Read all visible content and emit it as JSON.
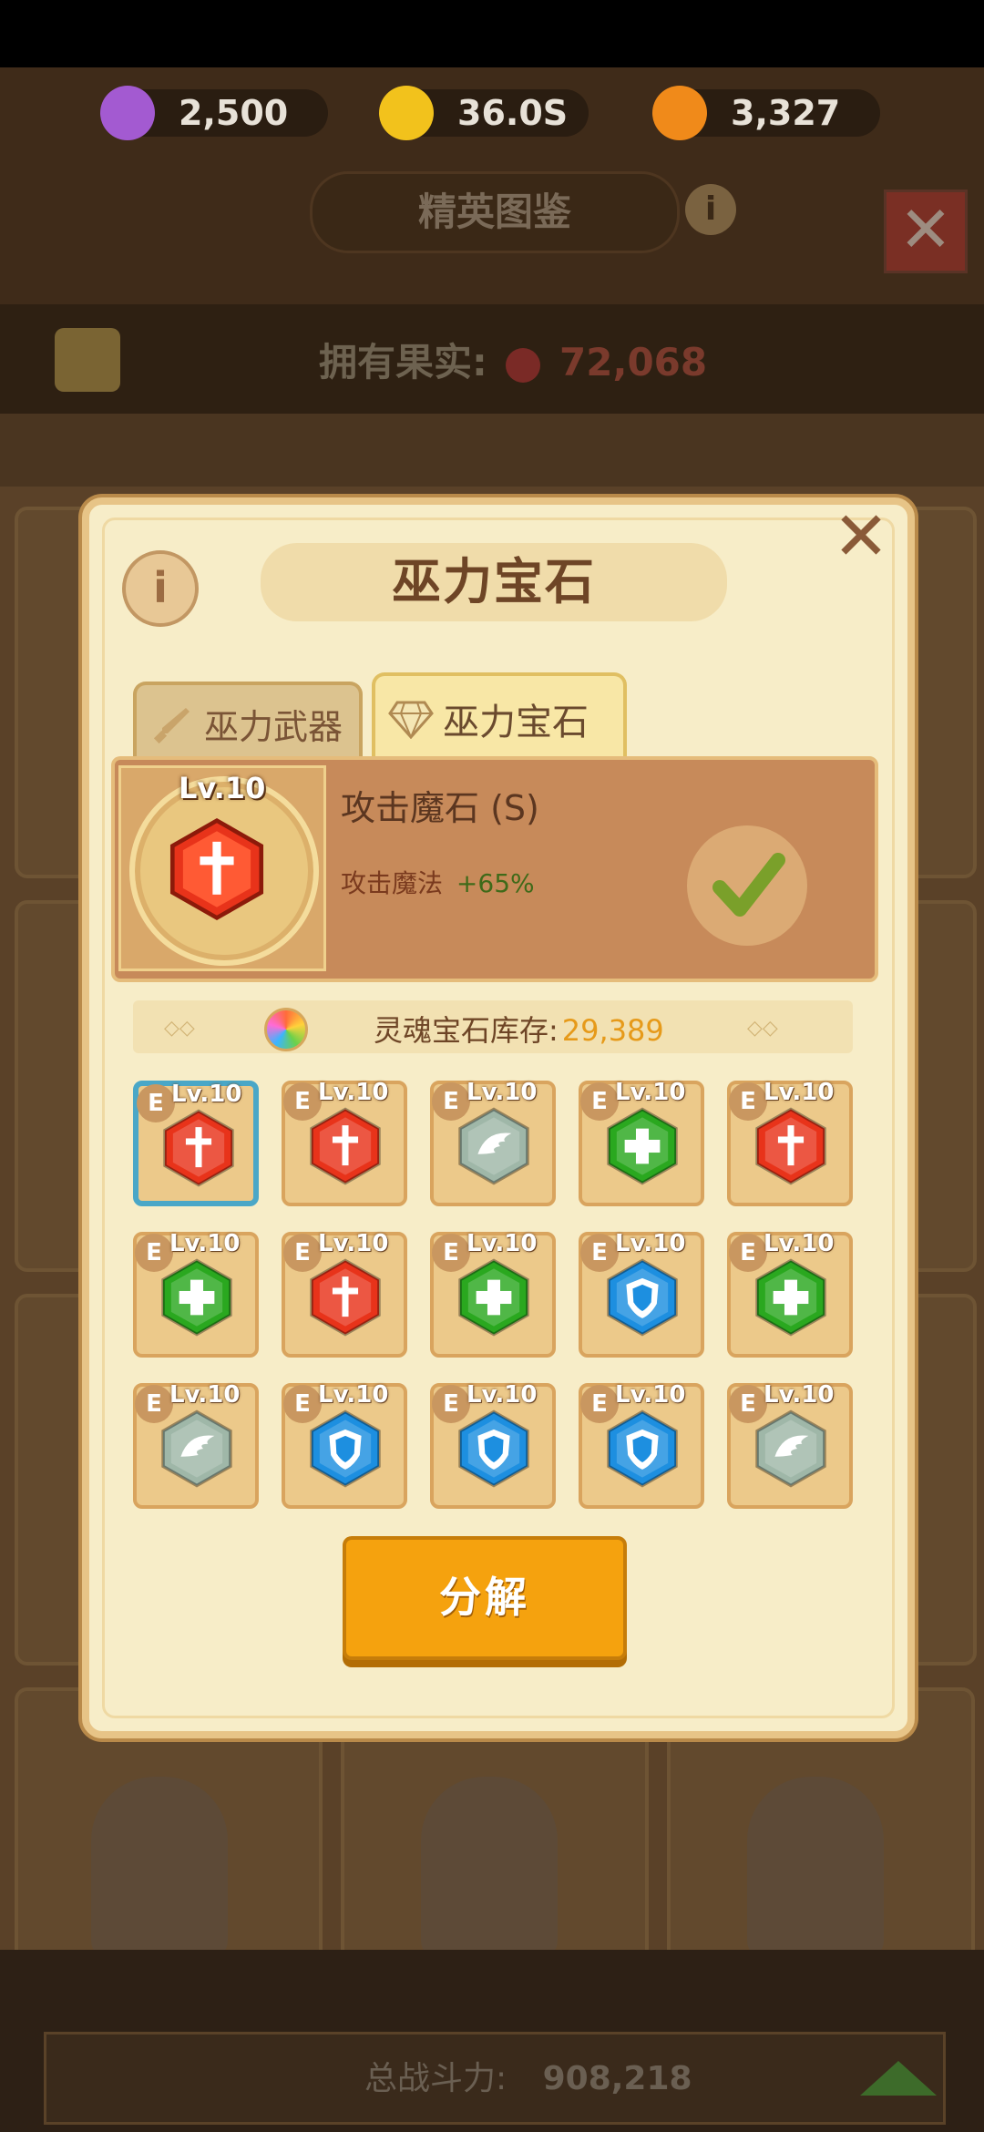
{
  "currencies": [
    {
      "name": "flower-gem",
      "value": "2,500",
      "color": "#a35ad1"
    },
    {
      "name": "gold-coin",
      "value": "36.0S",
      "color": "#f2c21c"
    },
    {
      "name": "amber-token",
      "value": "3,327",
      "color": "#f08a1a"
    }
  ],
  "background": {
    "title": "精英图鉴",
    "fruit_label": "拥有果实:",
    "fruit_value": "72,068",
    "power_label": "总战斗力:",
    "power_value": "908,218"
  },
  "modal": {
    "title": "巫力宝石",
    "tabs": [
      {
        "label": "巫力武器",
        "active": false
      },
      {
        "label": "巫力宝石",
        "active": true
      }
    ],
    "selected": {
      "level": "Lv.10",
      "name": "攻击魔石 (S)",
      "stat_label": "攻击魔法",
      "stat_bonus": "+65%",
      "gem_type": "attack"
    },
    "stock": {
      "label": "灵魂宝石库存:",
      "value": "29,389"
    },
    "grid": [
      {
        "grade": "E",
        "level": "Lv.10",
        "type": "attack",
        "selected": true
      },
      {
        "grade": "E",
        "level": "Lv.10",
        "type": "attack"
      },
      {
        "grade": "E",
        "level": "Lv.10",
        "type": "wing"
      },
      {
        "grade": "E",
        "level": "Lv.10",
        "type": "heal"
      },
      {
        "grade": "E",
        "level": "Lv.10",
        "type": "attack"
      },
      {
        "grade": "E",
        "level": "Lv.10",
        "type": "heal"
      },
      {
        "grade": "E",
        "level": "Lv.10",
        "type": "attack"
      },
      {
        "grade": "E",
        "level": "Lv.10",
        "type": "heal"
      },
      {
        "grade": "E",
        "level": "Lv.10",
        "type": "shield"
      },
      {
        "grade": "E",
        "level": "Lv.10",
        "type": "heal"
      },
      {
        "grade": "E",
        "level": "Lv.10",
        "type": "wing"
      },
      {
        "grade": "E",
        "level": "Lv.10",
        "type": "shield"
      },
      {
        "grade": "E",
        "level": "Lv.10",
        "type": "shield"
      },
      {
        "grade": "E",
        "level": "Lv.10",
        "type": "shield"
      },
      {
        "grade": "E",
        "level": "Lv.10",
        "type": "wing"
      }
    ],
    "decompose_label": "分解"
  },
  "gem_colors": {
    "attack": "#e8331a",
    "heal": "#2aa81f",
    "shield": "#1d8fe0",
    "wing": "#9fb7a8"
  }
}
